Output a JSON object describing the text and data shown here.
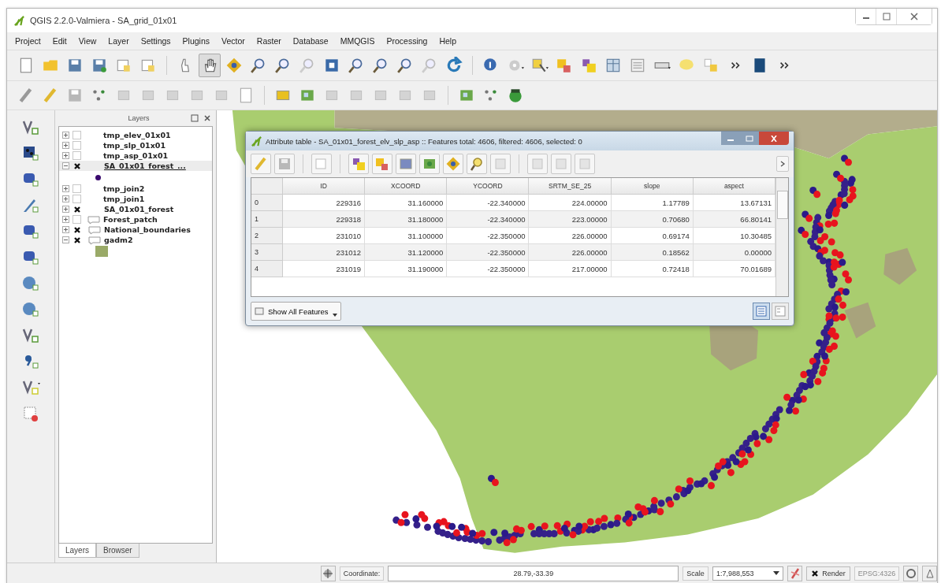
{
  "window": {
    "title": "QGIS 2.2.0-Valmiera - SA_grid_01x01"
  },
  "menu": [
    "Project",
    "Edit",
    "View",
    "Layer",
    "Settings",
    "Plugins",
    "Vector",
    "Raster",
    "Database",
    "MMQGIS",
    "Processing",
    "Help"
  ],
  "toolbar": {
    "pan_tool": {
      "selected": true
    }
  },
  "layers_panel": {
    "title": "Layers",
    "layers": [
      {
        "name": "tmp_elev_01x01",
        "kind": "raster",
        "checked": false,
        "expanded": false,
        "selected": false
      },
      {
        "name": "tmp_slp_01x01",
        "kind": "raster",
        "checked": false,
        "expanded": false,
        "selected": false
      },
      {
        "name": "tmp_asp_01x01",
        "kind": "raster",
        "checked": false,
        "expanded": false,
        "selected": false
      },
      {
        "name": "SA_01x01_forest_...",
        "kind": "point",
        "checked": true,
        "expanded": true,
        "selected": true,
        "children": [
          {
            "kind": "point-symbol",
            "color": "#3a0a6e"
          }
        ]
      },
      {
        "name": "tmp_join2",
        "kind": "raster",
        "checked": false,
        "expanded": false,
        "selected": false
      },
      {
        "name": "tmp_join1",
        "kind": "raster",
        "checked": false,
        "expanded": false,
        "selected": false
      },
      {
        "name": "SA_01x01_forest",
        "kind": "point",
        "checked": true,
        "expanded": false,
        "selected": false
      },
      {
        "name": "Forest_patch",
        "kind": "polygon",
        "checked": false,
        "expanded": false,
        "selected": false
      },
      {
        "name": "National_boundaries",
        "kind": "polygon",
        "checked": true,
        "expanded": false,
        "selected": false
      },
      {
        "name": "gadm2",
        "kind": "polygon",
        "checked": true,
        "expanded": true,
        "selected": false,
        "children": [
          {
            "kind": "fill-symbol",
            "color": "#9aaa68"
          }
        ]
      }
    ],
    "tabs": [
      {
        "label": "Layers",
        "selected": true
      },
      {
        "label": "Browser",
        "selected": false
      }
    ]
  },
  "attribute_table": {
    "title": "Attribute table - SA_01x01_forest_elv_slp_asp :: Features total: 4606, filtered: 4606, selected: 0",
    "columns": [
      "ID",
      "XCOORD",
      "YCOORD",
      "SRTM_SE_25",
      "slope",
      "aspect"
    ],
    "rows": [
      {
        "header": "0",
        "cells": [
          "229316",
          "31.160000",
          "-22.340000",
          "224.00000",
          "1.17789",
          "13.67131"
        ]
      },
      {
        "header": "1",
        "cells": [
          "229318",
          "31.180000",
          "-22.340000",
          "223.00000",
          "0.70680",
          "66.80141"
        ]
      },
      {
        "header": "2",
        "cells": [
          "231010",
          "31.100000",
          "-22.350000",
          "226.00000",
          "0.69174",
          "10.30485"
        ]
      },
      {
        "header": "3",
        "cells": [
          "231012",
          "31.120000",
          "-22.350000",
          "226.00000",
          "0.18562",
          "0.00000"
        ]
      },
      {
        "header": "4",
        "cells": [
          "231019",
          "31.190000",
          "-22.350000",
          "217.00000",
          "0.72418",
          "70.01689"
        ]
      }
    ],
    "filter_button": "Show All Features",
    "view_buttons": [
      {
        "kind": "table",
        "selected": true
      },
      {
        "kind": "form",
        "selected": false
      }
    ]
  },
  "status_bar": {
    "coordinate_label": "Coordinate:",
    "coordinate": "28.79,-33.39",
    "scale_label": "Scale",
    "scale": "1:7,988,553",
    "render": {
      "label": "Render",
      "checked": true
    },
    "crs": {
      "label": "EPSG:4326",
      "disabled": true
    }
  }
}
